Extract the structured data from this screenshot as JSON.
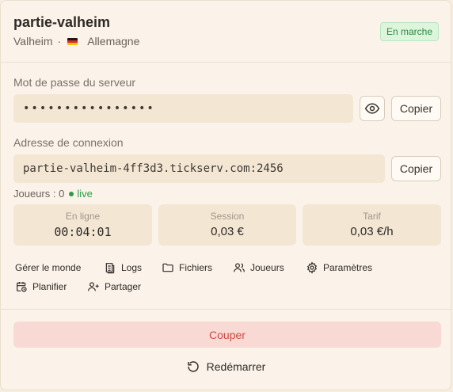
{
  "server": {
    "title": "partie-valheim",
    "game": "Valheim",
    "separator": "·",
    "country": "Allemagne",
    "status": "En marche"
  },
  "password": {
    "label": "Mot de passe du serveur",
    "masked_value": "••••••••••••••••",
    "copy_label": "Copier"
  },
  "connection": {
    "label": "Adresse de connexion",
    "address": "partie-valheim-4ff3d3.tickserv.com:2456",
    "copy_label": "Copier"
  },
  "players": {
    "text": "Joueurs : 0",
    "live_label": "live"
  },
  "stats": [
    {
      "label": "En ligne",
      "value": "00:04:01"
    },
    {
      "label": "Session",
      "value": "0,03 €"
    },
    {
      "label": "Tarif",
      "value": "0,03 €/h"
    }
  ],
  "actions": [
    {
      "label": "Gérer le monde",
      "icon": "none"
    },
    {
      "label": "Logs",
      "icon": "logs-icon"
    },
    {
      "label": "Fichiers",
      "icon": "folder-icon"
    },
    {
      "label": "Joueurs",
      "icon": "users-icon"
    },
    {
      "label": "Paramètres",
      "icon": "gear-icon"
    },
    {
      "label": "Planifier",
      "icon": "calendar-clock-icon"
    },
    {
      "label": "Partager",
      "icon": "user-plus-icon"
    }
  ],
  "controls": {
    "stop_label": "Couper",
    "restart_label": "Redémarrer"
  },
  "colors": {
    "status_green": "#2f8a3f",
    "stop_red": "#cf4a43",
    "background": "#fbf3ea"
  }
}
